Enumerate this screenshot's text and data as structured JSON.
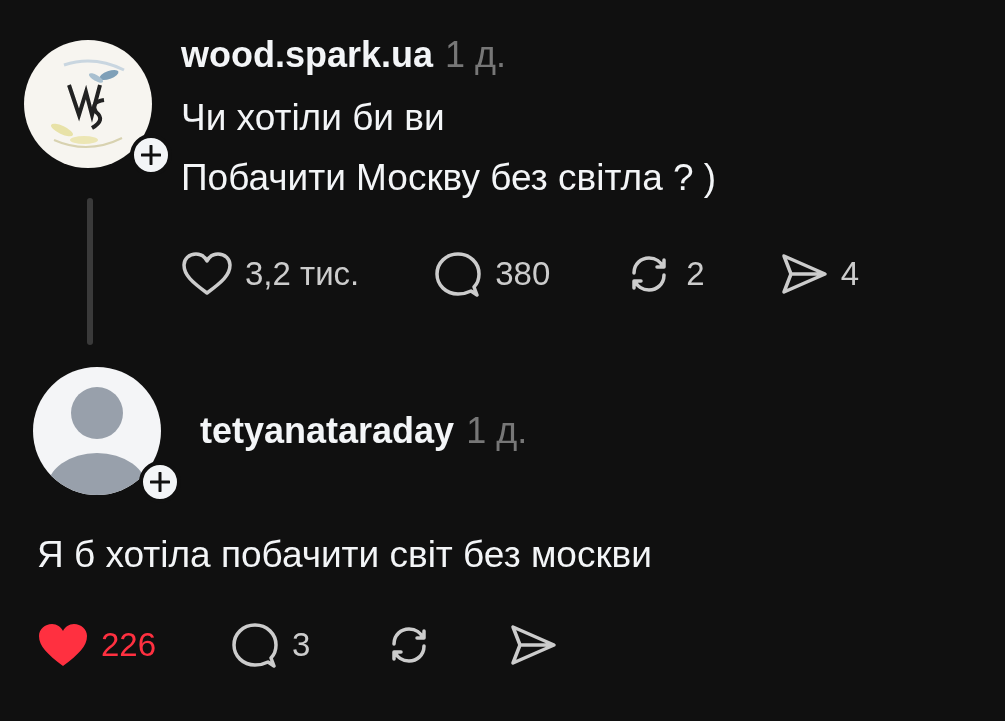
{
  "posts": [
    {
      "kind": "thread",
      "username": "wood.spark.ua",
      "time": "1 д.",
      "text": "Чи хотіли би ви\nПобачити Москву без світла ? )",
      "actions": [
        {
          "kind": "like",
          "liked": false,
          "count": "3,2 тис."
        },
        {
          "kind": "comment",
          "count": "380"
        },
        {
          "kind": "repost",
          "count": "2"
        },
        {
          "kind": "share",
          "count": "4"
        }
      ]
    },
    {
      "kind": "reply",
      "avatar": {
        "kind": "default"
      },
      "username": "tetyanataraday",
      "time": "1 д.",
      "text": "Я б хотіла побачити світ без москви",
      "actions": [
        {
          "kind": "like",
          "liked": true,
          "count": "226"
        },
        {
          "kind": "comment",
          "count": "3"
        },
        {
          "kind": "repost"
        },
        {
          "kind": "share"
        }
      ]
    }
  ]
}
